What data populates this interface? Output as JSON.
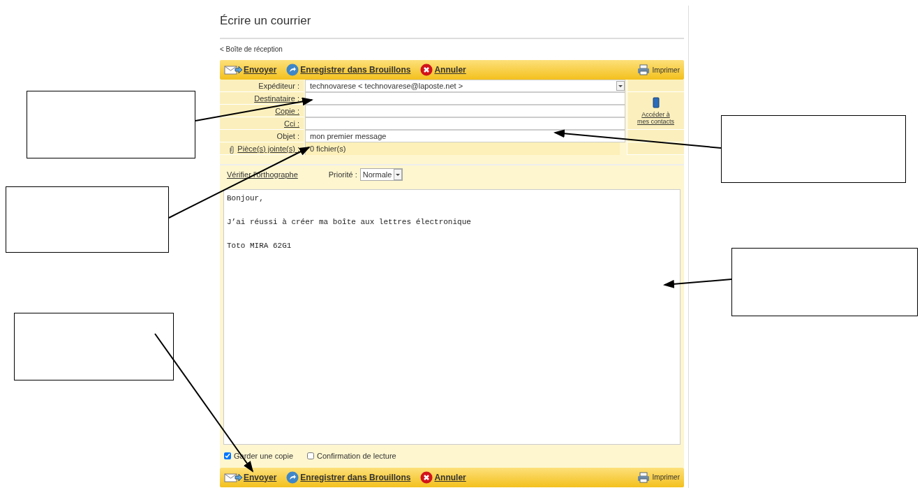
{
  "title": "Écrire un courrier",
  "back_link": {
    "arrow": "<",
    "label": "Boîte de réception"
  },
  "toolbars": [
    {
      "buttons": [
        {
          "kind": "send",
          "label": "Envoyer"
        },
        {
          "kind": "save",
          "label": "Enregistrer dans Brouillons"
        },
        {
          "kind": "cancel",
          "label": "Annuler"
        }
      ],
      "print": "Imprimer"
    },
    {
      "buttons": [
        {
          "kind": "send",
          "label": "Envoyer"
        },
        {
          "kind": "save",
          "label": "Enregistrer dans Brouillons"
        },
        {
          "kind": "cancel",
          "label": "Annuler"
        }
      ],
      "print": "Imprimer"
    }
  ],
  "fields": [
    {
      "kind": "select",
      "label": "Expéditeur :",
      "value": "technovarese < technovarese@laposte.net >"
    },
    {
      "kind": "link",
      "label": "Destinataire :"
    },
    {
      "kind": "link",
      "label": "Copie :"
    },
    {
      "kind": "link",
      "label": "Cci :"
    },
    {
      "kind": "text",
      "label": "Objet :",
      "value": "mon premier message"
    },
    {
      "kind": "attach",
      "label": "Pièce(s) jointe(s) :",
      "value": "0 fichier(s)"
    }
  ],
  "contacts_link": "Accéder à mes contacts",
  "spellcheck": "Vérifier l'orthographe",
  "priority": {
    "label": "Priorité :",
    "value": "Normale"
  },
  "body": [
    "Bonjour,",
    "J’ai réussi à créer ma boîte aux lettres électronique",
    "Toto MIRA 62G1"
  ],
  "options": [
    {
      "label": "Garder une copie",
      "checked": true
    },
    {
      "label": "Confirmation de lecture",
      "checked": false
    }
  ]
}
